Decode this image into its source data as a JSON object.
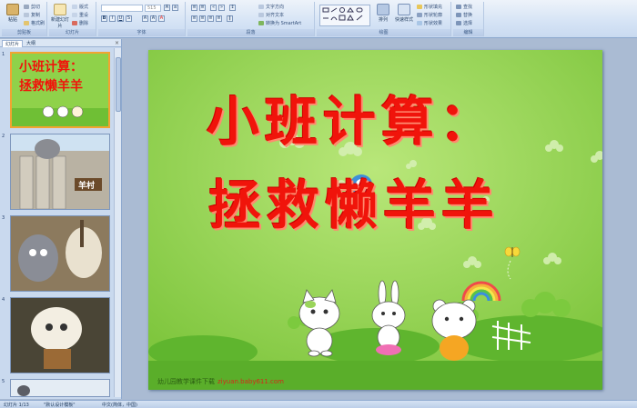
{
  "ribbon": {
    "clipboard": {
      "label": "剪贴板",
      "paste": "粘贴",
      "cut": "剪切",
      "copy": "复制",
      "format_painter": "格式刷"
    },
    "slides": {
      "label": "幻灯片",
      "new_slide": "新建幻灯片",
      "layout": "版式",
      "reset": "重设",
      "delete": "删除"
    },
    "font": {
      "label": "字体",
      "font_name": "",
      "font_size": "515"
    },
    "paragraph": {
      "label": "段落",
      "text_direction": "文字方向",
      "align_text": "对齐文本",
      "convert_smartart": "转换为 SmartArt"
    },
    "drawing": {
      "label": "绘图",
      "arrange": "排列",
      "quick_styles": "快速样式",
      "shape_fill": "形状填充",
      "shape_outline": "形状轮廓",
      "shape_effects": "形状效果"
    },
    "editing": {
      "label": "编辑",
      "find": "查找",
      "replace": "替换",
      "select": "选择"
    }
  },
  "left_pane": {
    "tabs": [
      "幻灯片",
      "大纲"
    ],
    "close": "×",
    "slide_numbers": [
      "1",
      "2",
      "3",
      "4",
      "5"
    ],
    "thumb1_title_line1": "小班计算：",
    "thumb1_title_line2": "拯救懒羊羊",
    "thumb2_sign": "羊村"
  },
  "slide": {
    "title_line1": "小班计算：",
    "title_line2": "拯救懒羊羊",
    "footer_text": "幼儿园教学课件下载",
    "footer_url": "ziyuan.baby611.com",
    "colors": {
      "background": "#8fd24a",
      "title": "#f0140b"
    }
  },
  "status_bar": {
    "slide_info": "幻灯片 1/13",
    "theme": "\"默认设计模板\"",
    "language": "中文(简体，中国)"
  }
}
